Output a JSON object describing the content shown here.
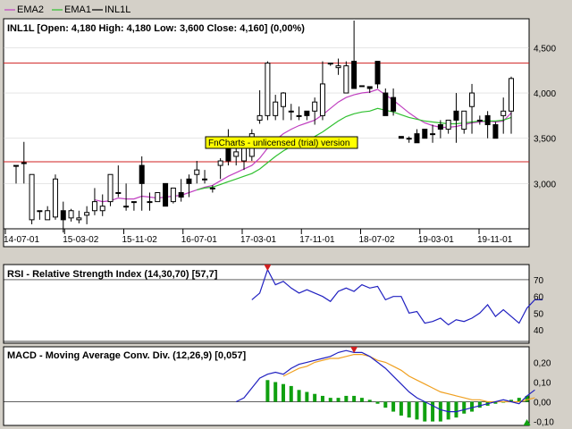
{
  "legend": [
    {
      "label": "EMA2",
      "color": "#c040c0"
    },
    {
      "label": "EMA1",
      "color": "#30c030"
    },
    {
      "label": "INL1L",
      "color": "#000000"
    }
  ],
  "price_panel": {
    "title": "INL1L [Open: 4,180  High: 4,180  Low: 3,600  Close: 4,160] (0,00%)",
    "y_ticks": [
      "4,500",
      "4,000",
      "3,500",
      "3,000"
    ],
    "x_ticks": [
      "14-07-01",
      "15-03-02",
      "15-11-02",
      "16-07-01",
      "17-03-01",
      "17-11-01",
      "18-07-02",
      "19-03-01",
      "19-11-01"
    ],
    "watermark": "FnCharts - unlicensed (trial) version"
  },
  "rsi_panel": {
    "title": "RSI - Relative Strength Index (14,30,70) [57,7]",
    "y_ticks": [
      "70",
      "60",
      "50",
      "40"
    ]
  },
  "macd_panel": {
    "title": "MACD - Moving Average Conv. Div. (12,26,9) [0,057]",
    "y_ticks": [
      "0,20",
      "0,10",
      "0,00",
      "-0,10"
    ]
  },
  "colors": {
    "ema2": "#c040c0",
    "ema1": "#30c030",
    "level_line": "#d02020",
    "rsi": "#2020c0",
    "macd": "#2020c0",
    "signal": "#f0a020",
    "histogram": "#10a010",
    "marker": "#d02020",
    "watermark_bg": "#ffff00"
  },
  "chart_data": [
    {
      "type": "candlestick",
      "title": "INL1L [Open: 4,180  High: 4,180  Low: 3,600  Close: 4,160] (0,00%)",
      "ylim": [
        2500,
        4800
      ],
      "levels": [
        4330,
        3240
      ],
      "candles": [
        [
          3200,
          3200,
          3000,
          3200
        ],
        [
          3230,
          3460,
          3000,
          3230
        ],
        [
          2600,
          3100,
          2550,
          3100
        ],
        [
          2700,
          2700,
          2600,
          2700
        ],
        [
          2600,
          2750,
          2600,
          2700
        ],
        [
          2630,
          3100,
          2600,
          3050
        ],
        [
          2700,
          2800,
          2460,
          2600
        ],
        [
          2620,
          2720,
          2580,
          2700
        ],
        [
          2600,
          2700,
          2560,
          2620
        ],
        [
          2650,
          2750,
          2550,
          2680
        ],
        [
          2700,
          2950,
          2650,
          2800
        ],
        [
          2700,
          2880,
          2640,
          2750
        ],
        [
          2800,
          3100,
          2750,
          3100
        ],
        [
          2900,
          3200,
          2850,
          2900
        ],
        [
          2750,
          3000,
          2700,
          2750
        ],
        [
          2800,
          2800,
          2700,
          2800
        ],
        [
          3200,
          3300,
          2700,
          3000
        ],
        [
          2800,
          2900,
          2700,
          2800
        ],
        [
          2800,
          2900,
          2800,
          2900
        ],
        [
          3000,
          3000,
          2750,
          2750
        ],
        [
          2800,
          2950,
          2780,
          2950
        ],
        [
          2900,
          3050,
          2800,
          2850
        ],
        [
          3050,
          3100,
          2850,
          3000
        ],
        [
          3100,
          3250,
          3000,
          3150
        ],
        [
          3050,
          3150,
          3000,
          3050
        ],
        [
          2950,
          2980,
          2900,
          2950
        ],
        [
          3200,
          3280,
          3050,
          3250
        ],
        [
          3450,
          3600,
          3200,
          3250
        ],
        [
          3300,
          3450,
          3200,
          3350
        ],
        [
          3250,
          3450,
          3150,
          3400
        ],
        [
          3300,
          3600,
          3250,
          3550
        ],
        [
          3700,
          4030,
          3660,
          3750
        ],
        [
          3750,
          4350,
          3700,
          4330
        ],
        [
          3750,
          3980,
          3700,
          3900
        ],
        [
          3850,
          4010,
          3700,
          4000
        ],
        [
          3800,
          3880,
          3700,
          3800
        ],
        [
          3750,
          3850,
          3700,
          3750
        ],
        [
          3800,
          3800,
          3700,
          3750
        ],
        [
          3800,
          3950,
          3650,
          3900
        ],
        [
          3750,
          4350,
          3700,
          4100
        ],
        [
          4330,
          4330,
          4300,
          4330
        ],
        [
          4280,
          4380,
          4200,
          4300
        ],
        [
          4000,
          4350,
          4000,
          4300
        ],
        [
          4350,
          4800,
          4050,
          4050
        ],
        [
          4080,
          4080,
          4080,
          4080
        ],
        [
          4070,
          4070,
          4000,
          4050
        ],
        [
          4350,
          4350,
          4050,
          4100
        ],
        [
          4000,
          4050,
          3750,
          3750
        ],
        [
          3950,
          4050,
          3750,
          3800
        ],
        [
          3520,
          3520,
          3500,
          3500
        ],
        [
          3500,
          3520,
          3450,
          3500
        ],
        [
          3550,
          3600,
          3450,
          3450
        ],
        [
          3600,
          3600,
          3500,
          3500
        ],
        [
          3550,
          3650,
          3450,
          3550
        ],
        [
          3650,
          3700,
          3500,
          3600
        ],
        [
          3600,
          3700,
          3550,
          3700
        ],
        [
          3800,
          4000,
          3450,
          3700
        ],
        [
          3600,
          3800,
          3550,
          3800
        ],
        [
          3850,
          4100,
          3550,
          4000
        ],
        [
          3700,
          3750,
          3650,
          3700
        ],
        [
          3750,
          3800,
          3500,
          3650
        ],
        [
          3650,
          3680,
          3500,
          3500
        ],
        [
          3750,
          3950,
          3550,
          3800
        ],
        [
          3800,
          4180,
          3550,
          4160
        ]
      ],
      "series": [
        {
          "name": "EMA2",
          "values": [
            null,
            null,
            null,
            null,
            null,
            null,
            null,
            null,
            null,
            null,
            2820,
            2800,
            2810,
            2840,
            2830,
            2830,
            2860,
            2850,
            2840,
            2850,
            2860,
            2870,
            2900,
            2930,
            2960,
            2980,
            3030,
            3080,
            3120,
            3160,
            3200,
            3280,
            3390,
            3480,
            3550,
            3600,
            3640,
            3670,
            3700,
            3760,
            3830,
            3900,
            3950,
            3980,
            4000,
            4010,
            4040,
            3980,
            3920,
            3850,
            3780,
            3720,
            3670,
            3640,
            3620,
            3620,
            3630,
            3650,
            3670,
            3680,
            3690,
            3680,
            3690,
            3780
          ]
        },
        {
          "name": "EMA1",
          "values": [
            null,
            null,
            null,
            null,
            null,
            null,
            null,
            null,
            null,
            null,
            null,
            null,
            null,
            null,
            null,
            null,
            null,
            null,
            null,
            null,
            null,
            null,
            null,
            2930,
            2950,
            2960,
            2990,
            3020,
            3050,
            3080,
            3110,
            3160,
            3230,
            3300,
            3360,
            3410,
            3450,
            3480,
            3520,
            3570,
            3630,
            3690,
            3740,
            3770,
            3790,
            3800,
            3830,
            3810,
            3790,
            3760,
            3730,
            3710,
            3690,
            3680,
            3670,
            3660,
            3660,
            3670,
            3680,
            3690,
            3690,
            3690,
            3700,
            3730
          ]
        }
      ]
    },
    {
      "type": "line",
      "title": "RSI - Relative Strength Index (14,30,70) [57,7]",
      "ylim": [
        32,
        78
      ],
      "series": [
        {
          "name": "RSI",
          "values": [
            null,
            null,
            null,
            null,
            null,
            null,
            null,
            null,
            null,
            null,
            null,
            null,
            null,
            null,
            null,
            null,
            null,
            null,
            null,
            null,
            null,
            null,
            null,
            null,
            null,
            null,
            null,
            null,
            null,
            null,
            58,
            62,
            76,
            67,
            69,
            65,
            62,
            64,
            62,
            60,
            57,
            63,
            65,
            63,
            67,
            65,
            66,
            58,
            60,
            60,
            50,
            51,
            44,
            45,
            47,
            43,
            46,
            45,
            47,
            50,
            55,
            48,
            52,
            48,
            44,
            53,
            58,
            58
          ]
        }
      ]
    },
    {
      "type": "bar+line",
      "title": "MACD - Moving Average Conv. Div. (12,26,9) [0,057]",
      "ylim": [
        -0.12,
        0.27
      ],
      "series": [
        {
          "name": "MACD",
          "values": [
            null,
            null,
            null,
            null,
            null,
            null,
            null,
            null,
            null,
            null,
            null,
            null,
            null,
            null,
            null,
            null,
            null,
            null,
            null,
            null,
            null,
            null,
            null,
            null,
            null,
            null,
            null,
            null,
            0.0,
            0.02,
            0.07,
            0.12,
            0.14,
            0.15,
            0.14,
            0.17,
            0.19,
            0.2,
            0.21,
            0.22,
            0.23,
            0.25,
            0.26,
            0.25,
            0.25,
            0.23,
            0.2,
            0.17,
            0.13,
            0.09,
            0.05,
            0.02,
            0.0,
            -0.02,
            -0.04,
            -0.05,
            -0.05,
            -0.04,
            -0.03,
            -0.02,
            -0.01,
            -0.0,
            0.01,
            0.0,
            -0.01,
            0.03,
            0.06
          ]
        },
        {
          "name": "Signal",
          "values": [
            null,
            null,
            null,
            null,
            null,
            null,
            null,
            null,
            null,
            null,
            null,
            null,
            null,
            null,
            null,
            null,
            null,
            null,
            null,
            null,
            null,
            null,
            null,
            null,
            null,
            null,
            null,
            null,
            null,
            null,
            null,
            null,
            null,
            null,
            0.13,
            0.15,
            0.17,
            0.18,
            0.2,
            0.21,
            0.22,
            0.22,
            0.23,
            0.24,
            0.24,
            0.23,
            0.21,
            0.2,
            0.18,
            0.16,
            0.13,
            0.11,
            0.09,
            0.07,
            0.05,
            0.04,
            0.03,
            0.02,
            0.01,
            0.01,
            0.0,
            0.0,
            0.0,
            0.0,
            0.0,
            0.01,
            0.02
          ]
        },
        {
          "name": "Histogram",
          "values": [
            null,
            null,
            null,
            null,
            null,
            null,
            null,
            null,
            null,
            null,
            null,
            null,
            null,
            null,
            null,
            null,
            null,
            null,
            null,
            null,
            null,
            null,
            null,
            null,
            null,
            null,
            null,
            null,
            null,
            null,
            null,
            null,
            0.11,
            0.1,
            0.09,
            0.08,
            0.06,
            0.05,
            0.04,
            0.03,
            0.02,
            0.02,
            0.03,
            0.03,
            0.02,
            0.01,
            -0.01,
            -0.03,
            -0.05,
            -0.07,
            -0.08,
            -0.09,
            -0.1,
            -0.1,
            -0.1,
            -0.09,
            -0.08,
            -0.06,
            -0.05,
            -0.03,
            -0.02,
            -0.01,
            0.0,
            0.01,
            0.02,
            0.03
          ]
        }
      ]
    }
  ]
}
